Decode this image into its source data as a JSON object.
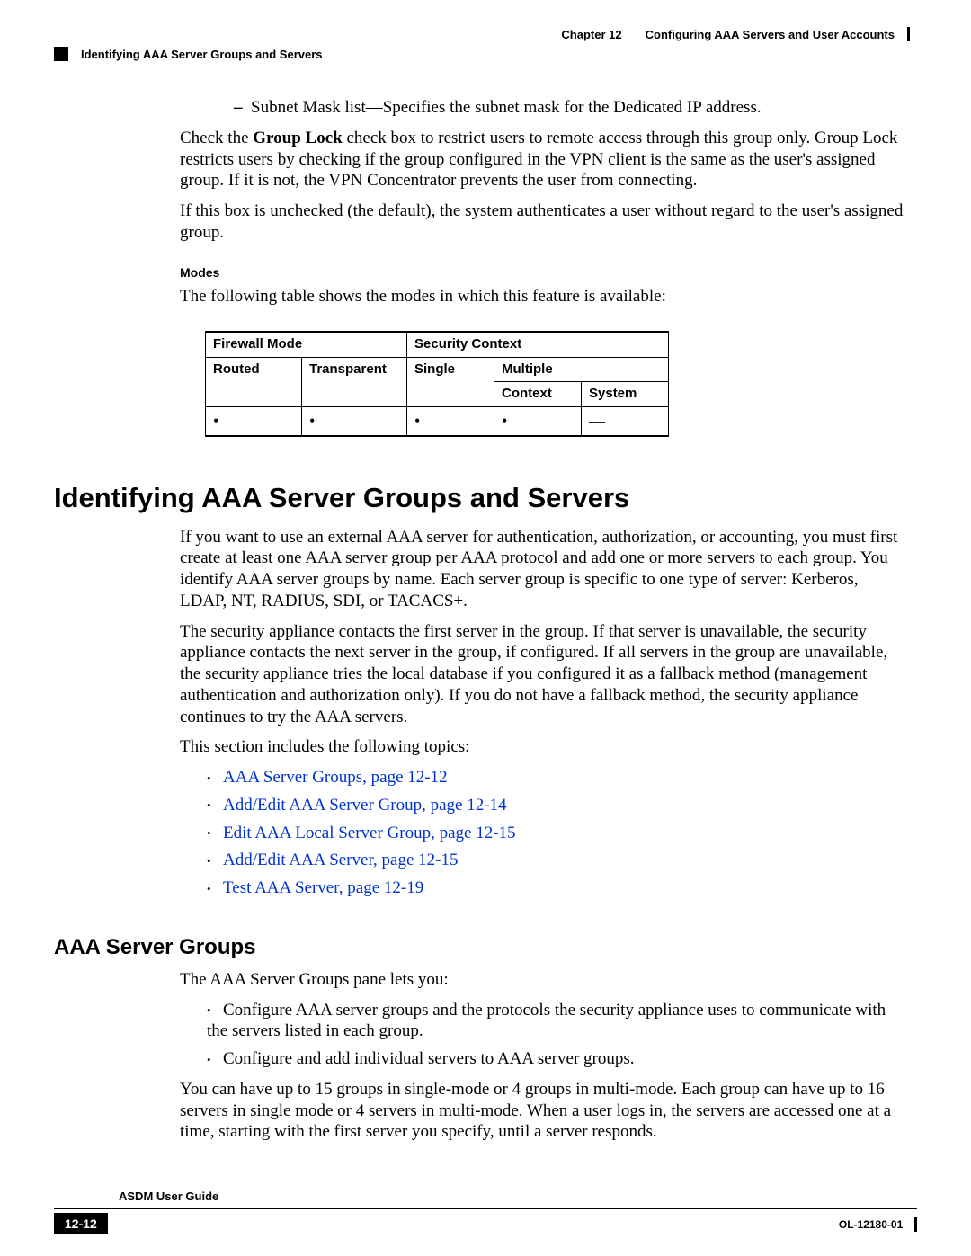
{
  "header": {
    "chapter": "Chapter 12",
    "title": "Configuring AAA Servers and User Accounts",
    "section": "Identifying AAA Server Groups and Servers"
  },
  "body": {
    "dash_bullet": "Subnet Mask list—Specifies the subnet mask for the Dedicated IP address.",
    "p1_a": "Check the ",
    "p1_b": "Group Lock",
    "p1_c": " check box to restrict users to remote access through this group only. Group Lock restricts users by checking if the group configured in the VPN client is the same as the user's assigned group. If it is not, the VPN Concentrator prevents the user from connecting.",
    "p2": "If this box is unchecked (the default), the system authenticates a user without regard to the user's assigned group.",
    "modes_label": "Modes",
    "modes_intro": "The following table shows the modes in which this feature is available:"
  },
  "table": {
    "h_firewall": "Firewall Mode",
    "h_security": "Security Context",
    "h_multiple": "Multiple",
    "h_routed": "Routed",
    "h_transparent": "Transparent",
    "h_single": "Single",
    "h_context": "Context",
    "h_system": "System",
    "dot": "•",
    "dash": "—"
  },
  "main": {
    "h1": "Identifying AAA Server Groups and Servers",
    "p1": "If you want to use an external AAA server for authentication, authorization, or accounting, you must first create at least one AAA server group per AAA protocol and add one or more servers to each group. You identify AAA server groups by name. Each server group is specific to one type of server: Kerberos, LDAP, NT, RADIUS, SDI, or TACACS+.",
    "p2": "The security appliance contacts the first server in the group. If that server is unavailable, the security appliance contacts the next server in the group, if configured. If all servers in the group are unavailable, the security appliance tries the local database if you configured it as a fallback method (management authentication and authorization only). If you do not have a fallback method, the security appliance continues to try the AAA servers.",
    "p3": "This section includes the following topics:",
    "links": [
      "AAA Server Groups, page 12-12",
      "Add/Edit AAA Server Group, page 12-14",
      "Edit AAA Local Server Group, page 12-15",
      "Add/Edit AAA Server, page 12-15",
      "Test AAA Server, page 12-19"
    ]
  },
  "sub": {
    "h2": "AAA Server Groups",
    "p1": "The AAA Server Groups pane lets you:",
    "bullets": [
      "Configure AAA server groups and the protocols the security appliance uses to communicate with the servers listed in each group.",
      "Configure and add individual servers to AAA server groups."
    ],
    "p2": "You can have up to 15 groups in single-mode or 4 groups in multi-mode. Each group can have up to 16 servers in single mode or 4 servers in multi-mode. When a user logs in, the servers are accessed one at a time, starting with the first server you specify, until a server responds."
  },
  "footer": {
    "guide": "ASDM User Guide",
    "page": "12-12",
    "docid": "OL-12180-01"
  }
}
